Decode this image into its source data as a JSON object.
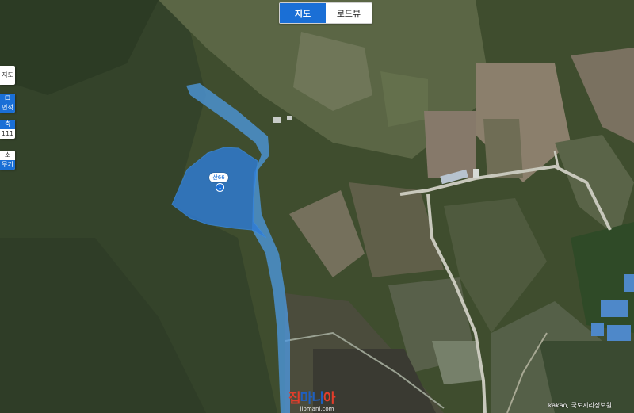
{
  "map_controls": {
    "map_label": "지도",
    "roadview_label": "로드뷰"
  },
  "side_controls": {
    "map_type": "지도",
    "item2_top": "ロ",
    "item2_bottom": "면적",
    "item3_top": "축",
    "item3_bottom": "111",
    "item4_top": "소",
    "item4_bottom": "무기"
  },
  "parcel": {
    "label": "산66",
    "number": "1",
    "fill_color": "#2f7cd6",
    "stream_color": "#4d9be6"
  },
  "watermark": {
    "logo_part1": "집",
    "logo_part2": "마니",
    "logo_part3": "아",
    "url": "jipmani.com"
  },
  "copyright": "kakao, 국토지리정보원"
}
